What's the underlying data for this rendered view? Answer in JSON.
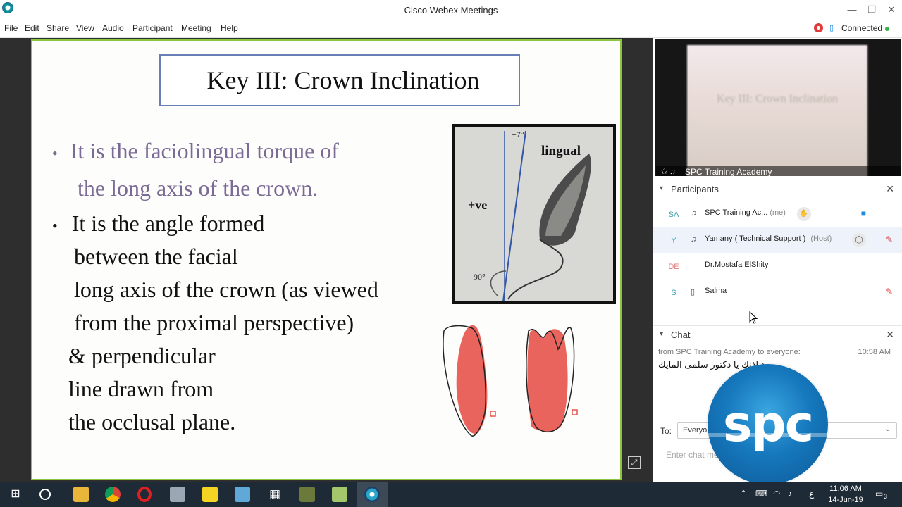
{
  "window": {
    "title": "Cisco Webex Meetings"
  },
  "menu": [
    "File",
    "Edit",
    "Share",
    "View",
    "Audio",
    "Participant",
    "Meeting",
    "Help"
  ],
  "connection": {
    "status": "Connected"
  },
  "slide": {
    "title": "Key III: Crown Inclination",
    "bullet1_line1": "It is the faciolingual torque of",
    "bullet1_line2": "the long axis of the crown.",
    "bullet2_lines": [
      "It is the angle formed",
      "between the facial",
      "long axis of the crown (as viewed",
      "from the proximal perspective)",
      "& perpendicular",
      "line drawn from",
      "the occlusal plane."
    ],
    "figure_labels": {
      "top": "+7°",
      "lingual": "lingual",
      "positive": "+ve",
      "angle": "90°"
    }
  },
  "video": {
    "label": "SPC Training Academy",
    "screen_text": "Key III: Crown Inclination"
  },
  "participants_panel": {
    "title": "Participants",
    "items": [
      {
        "initials": "SA",
        "name": "SPC Training Ac...",
        "role": "(me)"
      },
      {
        "initials": "Y",
        "name": "Yamany ( Technical Support )",
        "role": "(Host)"
      },
      {
        "initials": "DE",
        "name": "Dr.Mostafa ElShity",
        "role": ""
      },
      {
        "initials": "S",
        "name": "Salma",
        "role": ""
      }
    ]
  },
  "chat_panel": {
    "title": "Chat",
    "from": "from SPC Training Academy to everyone:",
    "time": "10:58 AM",
    "message": "بعد اذنك يا دكتور سلمى المايك",
    "to_label": "To:",
    "to_value": "Everyone",
    "input_placeholder": "Enter chat message here"
  },
  "logo": {
    "text": "spc"
  },
  "taskbar": {
    "time": "11:06 AM",
    "date": "14-Jun-19",
    "notifications": "3",
    "lang": "ع"
  },
  "colors": {
    "slide_border": "#8cc63f",
    "title_box_border": "#6a7fb5",
    "bullet_accent": "#7b6a96",
    "taskbar": "#1e2a36",
    "tooth_fill": "#e8534c"
  }
}
